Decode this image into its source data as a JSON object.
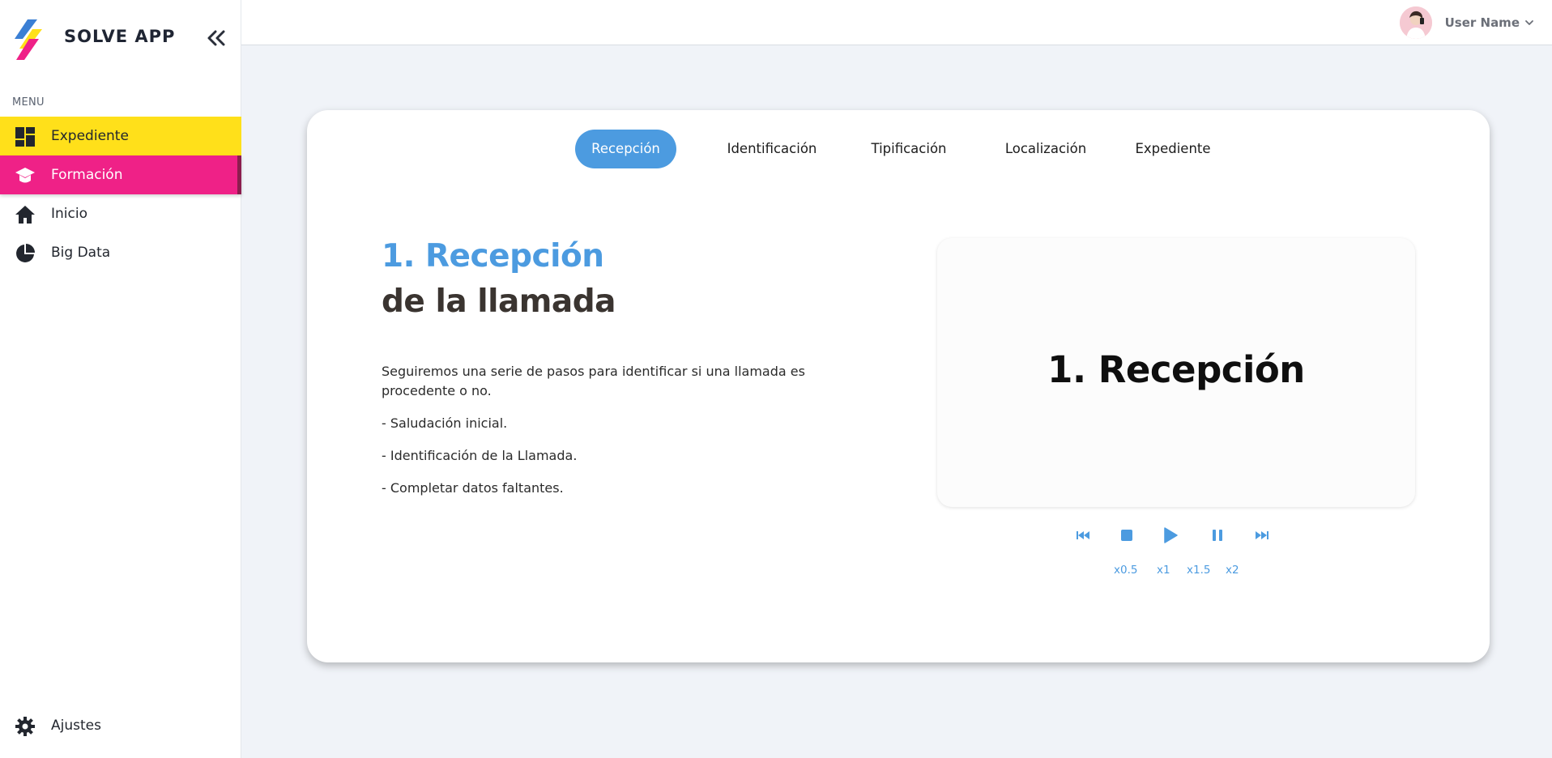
{
  "app": {
    "name": "SOLVE APP"
  },
  "sidebar": {
    "menu_label": "MENU",
    "items": [
      {
        "label": "Expediente",
        "icon": "dashboard-icon"
      },
      {
        "label": "Formación",
        "icon": "graduation-cap-icon"
      },
      {
        "label": "Inicio",
        "icon": "home-icon"
      },
      {
        "label": "Big Data",
        "icon": "pie-chart-icon"
      }
    ],
    "settings": {
      "label": "Ajustes",
      "icon": "gear-icon"
    }
  },
  "header": {
    "user_name": "User Name"
  },
  "tabs": [
    "Recepción",
    "Identificación",
    "Tipificación",
    "Localización",
    "Expediente"
  ],
  "content": {
    "title_accent": "1. Recepción",
    "title_rest": "de la llamada",
    "paragraphs": [
      "Seguiremos una serie de pasos para identificar si una llamada es procedente o no.",
      "- Saludación inicial.",
      "- Identificación de la Llamada.",
      "- Completar datos faltantes."
    ]
  },
  "video": {
    "title": "1. Recepción"
  },
  "player": {
    "speeds": [
      "x0.5",
      "x1",
      "x1.5",
      "x2"
    ]
  },
  "colors": {
    "accent_blue": "#4c9be0",
    "yellow": "#ffe01a",
    "pink": "#ef2187",
    "background": "#f0f3f8"
  }
}
